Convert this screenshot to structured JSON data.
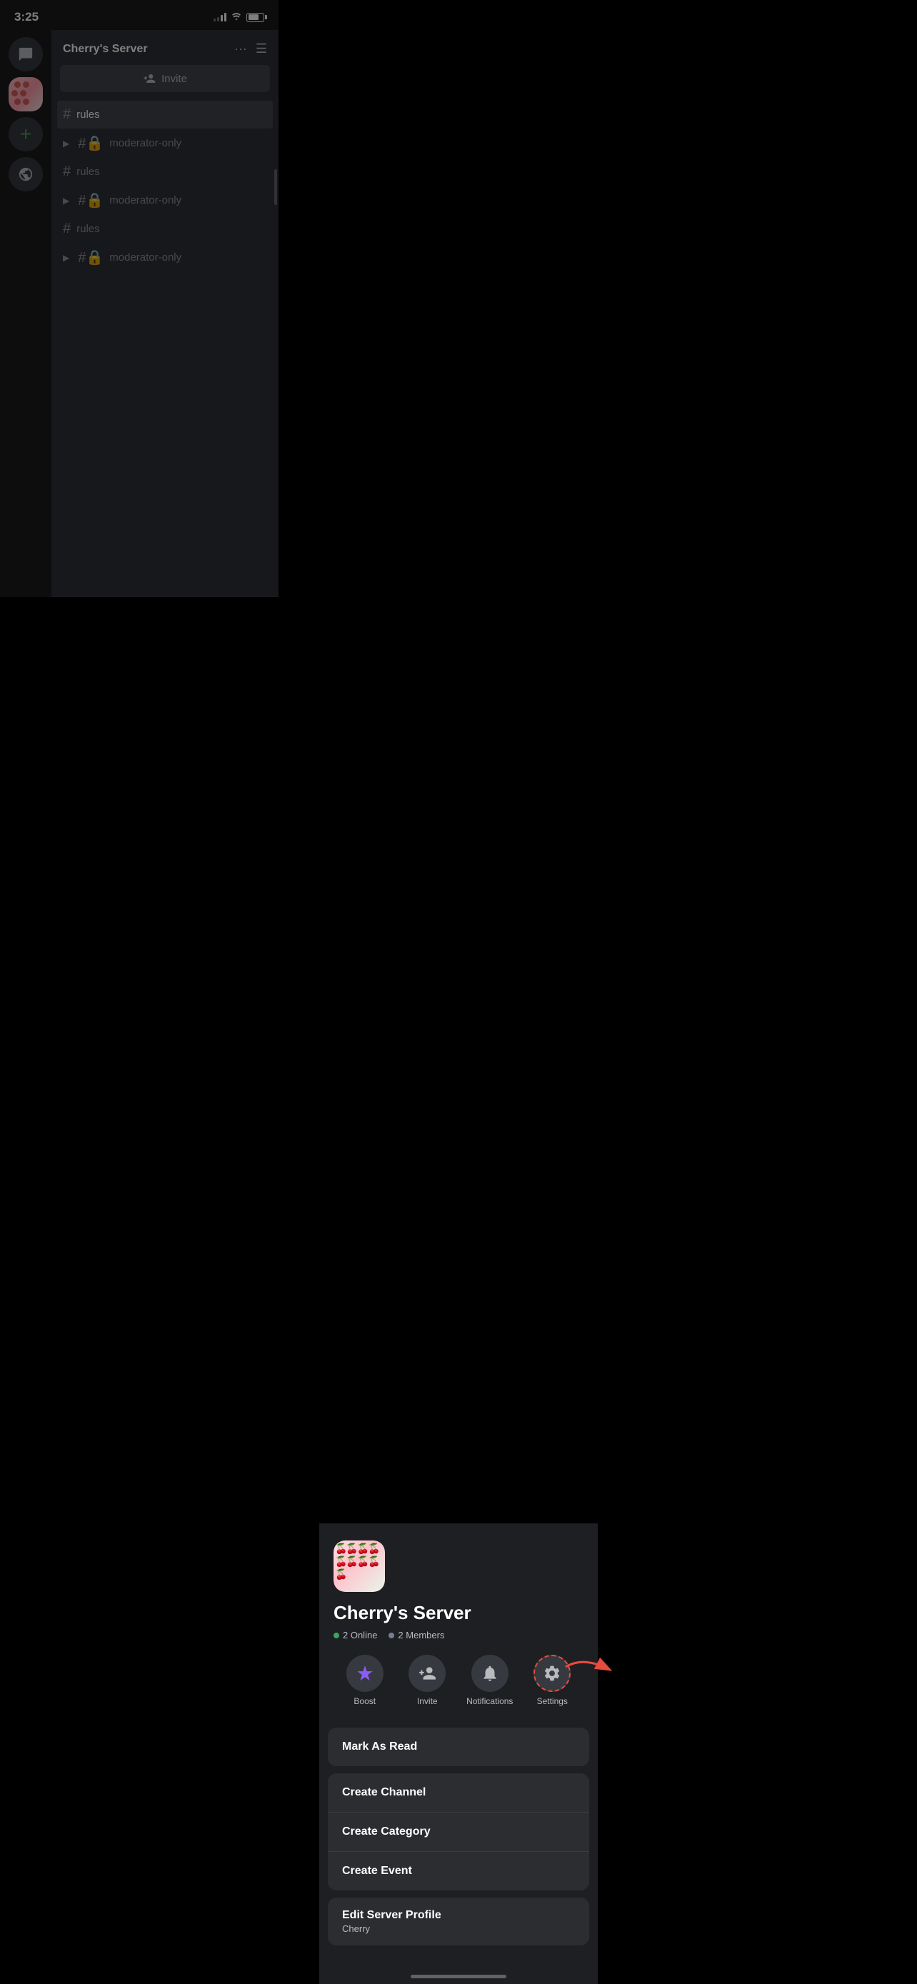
{
  "statusBar": {
    "time": "3:25"
  },
  "sidebar": {
    "items": [
      {
        "id": "dm",
        "label": "Direct Messages",
        "icon": "chat"
      },
      {
        "id": "cherry-server",
        "label": "Cherry's Server",
        "icon": "cherry"
      },
      {
        "id": "add",
        "label": "Add a Server",
        "icon": "plus"
      },
      {
        "id": "discover",
        "label": "Discover",
        "icon": "discover"
      }
    ]
  },
  "channelList": {
    "serverName": "Cherry's Server",
    "inviteLabel": "Invite",
    "channels": [
      {
        "id": "rules-1",
        "name": "rules",
        "type": "text",
        "active": true,
        "locked": false
      },
      {
        "id": "mod-1",
        "name": "moderator-only",
        "type": "text",
        "active": false,
        "locked": true,
        "collapsed": true
      },
      {
        "id": "rules-2",
        "name": "rules",
        "type": "text",
        "active": false,
        "locked": false
      },
      {
        "id": "mod-2",
        "name": "moderator-only",
        "type": "text",
        "active": false,
        "locked": true,
        "collapsed": true
      },
      {
        "id": "rules-3",
        "name": "rules",
        "type": "text",
        "active": false,
        "locked": false
      },
      {
        "id": "mod-3",
        "name": "moderator-only",
        "type": "text",
        "active": false,
        "locked": true,
        "collapsed": true
      }
    ]
  },
  "bottomSheet": {
    "serverName": "Cherry's Server",
    "stats": {
      "online": "2 Online",
      "members": "2 Members"
    },
    "actions": [
      {
        "id": "boost",
        "label": "Boost",
        "icon": "boost"
      },
      {
        "id": "invite",
        "label": "Invite",
        "icon": "invite"
      },
      {
        "id": "notifications",
        "label": "Notifications",
        "icon": "bell"
      },
      {
        "id": "settings",
        "label": "Settings",
        "icon": "gear",
        "highlighted": true
      }
    ],
    "menuItems": [
      {
        "id": "mark-as-read",
        "label": "Mark As Read"
      }
    ],
    "menuItems2": [
      {
        "id": "create-channel",
        "label": "Create Channel"
      },
      {
        "id": "create-category",
        "label": "Create Category"
      },
      {
        "id": "create-event",
        "label": "Create Event"
      }
    ],
    "editProfile": {
      "label": "Edit Server Profile",
      "sub": "Cherry"
    }
  }
}
